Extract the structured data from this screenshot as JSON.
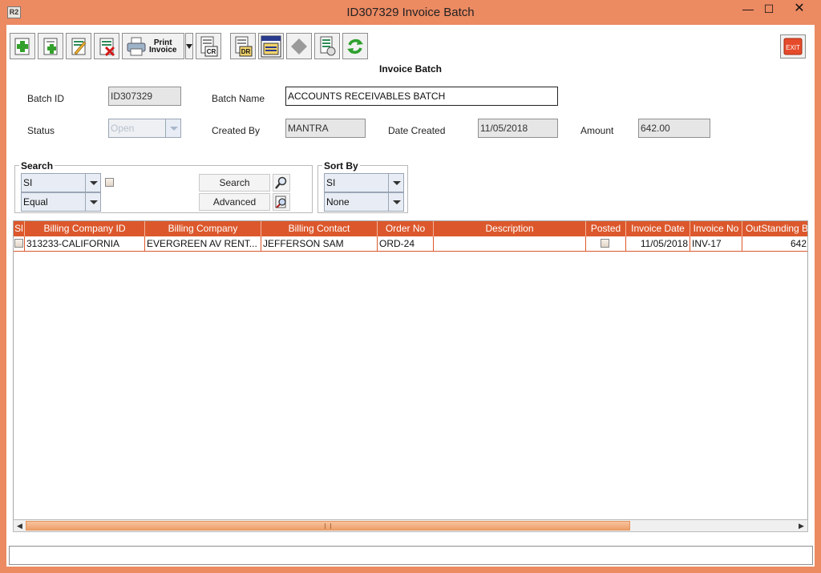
{
  "window": {
    "title": "ID307329 Invoice Batch",
    "app_icon_text": "R2",
    "minimize_glyph": "—",
    "maximize_glyph": "☐",
    "close_glyph": "✕"
  },
  "toolbar": {
    "buttons": [
      {
        "name": "new-icon"
      },
      {
        "name": "add-icon"
      },
      {
        "name": "edit-icon"
      },
      {
        "name": "delete-icon"
      },
      {
        "name": "print-invoice-icon"
      },
      {
        "name": "credit-note-icon",
        "text": "CR"
      },
      {
        "name": "debit-note-icon",
        "text": "DR"
      },
      {
        "name": "full-credit-icon",
        "text": "INVOICE Full Credit"
      },
      {
        "name": "post-icon"
      },
      {
        "name": "batch-list-icon"
      },
      {
        "name": "refresh-icon"
      }
    ],
    "print_label_1": "Print",
    "print_label_2": "Invoice",
    "exit_label": "EXIT"
  },
  "form": {
    "title": "Invoice Batch",
    "batch_id_label": "Batch ID",
    "batch_id_value": "ID307329",
    "batch_name_label": "Batch Name",
    "batch_name_value": "ACCOUNTS RECEIVABLES BATCH",
    "status_label": "Status",
    "status_value": "Open",
    "created_by_label": "Created By",
    "created_by_value": "MANTRA",
    "date_created_label": "Date Created",
    "date_created_value": "11/05/2018",
    "amount_label": "Amount",
    "amount_value": "642.00"
  },
  "search": {
    "title": "Search",
    "field_value": "SI",
    "operator_value": "Equal",
    "search_button": "Search",
    "advanced_button": "Advanced"
  },
  "sort": {
    "title": "Sort By",
    "field_value": "SI",
    "order_value": "None"
  },
  "table": {
    "columns": [
      "Sl",
      "Billing Company ID",
      "Billing Company",
      "Billing Contact",
      "Order No",
      "Description",
      "Posted",
      "Invoice Date",
      "Invoice No",
      "OutStanding B"
    ],
    "rows": [
      {
        "billing_company_id": "313233-CALIFORNIA",
        "billing_company": "EVERGREEN AV RENT...",
        "billing_contact": "JEFFERSON SAM",
        "order_no": "ORD-24",
        "description": "",
        "posted": false,
        "invoice_date": "11/05/2018",
        "invoice_no": "INV-17",
        "outstanding": "642"
      }
    ]
  },
  "colors": {
    "frame": "#ec8a62",
    "header": "#dc582c",
    "scroll_thumb": "#ee9f6a"
  }
}
